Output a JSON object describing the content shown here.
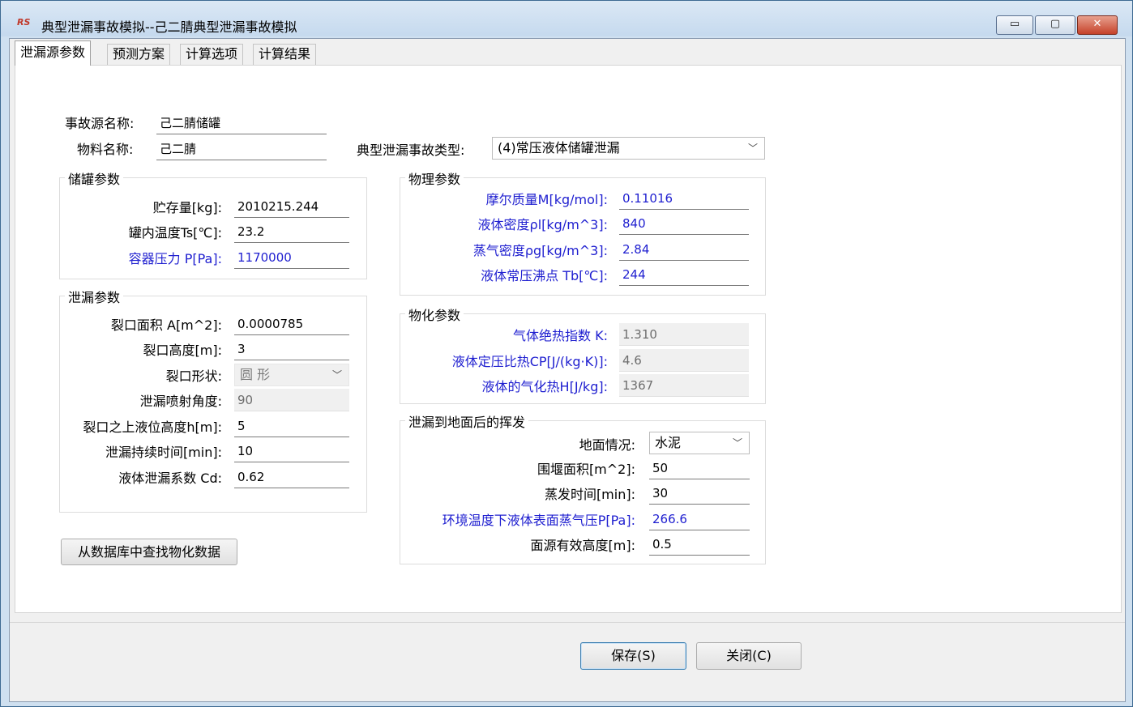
{
  "window": {
    "title": "典型泄漏事故模拟--己二腈典型泄漏事故模拟",
    "icon_text": "RS",
    "min_glyph": "▭",
    "max_glyph": "▢",
    "close_glyph": "✕"
  },
  "tabs": [
    {
      "label": "泄漏源参数"
    },
    {
      "label": "预测方案"
    },
    {
      "label": "计算选项"
    },
    {
      "label": "计算结果"
    }
  ],
  "source": {
    "name_label": "事故源名称:",
    "name_value": "己二腈储罐",
    "material_label": "物料名称:",
    "material_value": "己二腈",
    "type_label": "典型泄漏事故类型:",
    "type_value": "(4)常压液体储罐泄漏"
  },
  "tank": {
    "title": "储罐参数",
    "fields": [
      {
        "label": "贮存量[kg]:",
        "value": "2010215.244"
      },
      {
        "label": "罐内温度Ts[℃]:",
        "value": "23.2"
      },
      {
        "label": "容器压力 P[Pa]:",
        "value": "1170000"
      }
    ]
  },
  "leak": {
    "title": "泄漏参数",
    "area_label": "裂口面积 A[m^2]:",
    "area_value": "0.0000785",
    "height_label": "裂口高度[m]:",
    "height_value": "3",
    "shape_label": "裂口形状:",
    "shape_value": "圆  形",
    "angle_label": "泄漏喷射角度:",
    "angle_value": "90",
    "level_label": "裂口之上液位高度h[m]:",
    "level_value": "5",
    "duration_label": "泄漏持续时间[min]:",
    "duration_value": "10",
    "coef_label": "液体泄漏系数  Cd:",
    "coef_value": "0.62"
  },
  "physical": {
    "title": "物理参数",
    "fields": [
      {
        "label": "摩尔质量M[kg/mol]:",
        "value": "0.11016"
      },
      {
        "label": "液体密度ρl[kg/m^3]:",
        "value": "840"
      },
      {
        "label": "蒸气密度ρg[kg/m^3]:",
        "value": "2.84"
      },
      {
        "label": "液体常压沸点  Tb[℃]:",
        "value": "244"
      }
    ]
  },
  "chemical": {
    "title": "物化参数",
    "fields": [
      {
        "label": "气体绝热指数  K:",
        "value": "1.310"
      },
      {
        "label": "液体定压比热CP[J/(kg·K)]:",
        "value": "4.6"
      },
      {
        "label": "液体的气化热H[J/kg]:",
        "value": "1367"
      }
    ]
  },
  "evap": {
    "title": "泄漏到地面后的挥发",
    "ground_label": "地面情况:",
    "ground_value": "水泥",
    "fields": [
      {
        "label": "围堰面积[m^2]:",
        "value": "50"
      },
      {
        "label": "蒸发时间[min]:",
        "value": "30"
      },
      {
        "label": "环境温度下液体表面蒸气压P[Pa]:",
        "value": "266.6"
      },
      {
        "label": "面源有效高度[m]:",
        "value": "0.5"
      }
    ]
  },
  "buttons": {
    "lookup": "从数据库中查找物化数据",
    "save": "保存(S)",
    "close": "关闭(C)"
  }
}
